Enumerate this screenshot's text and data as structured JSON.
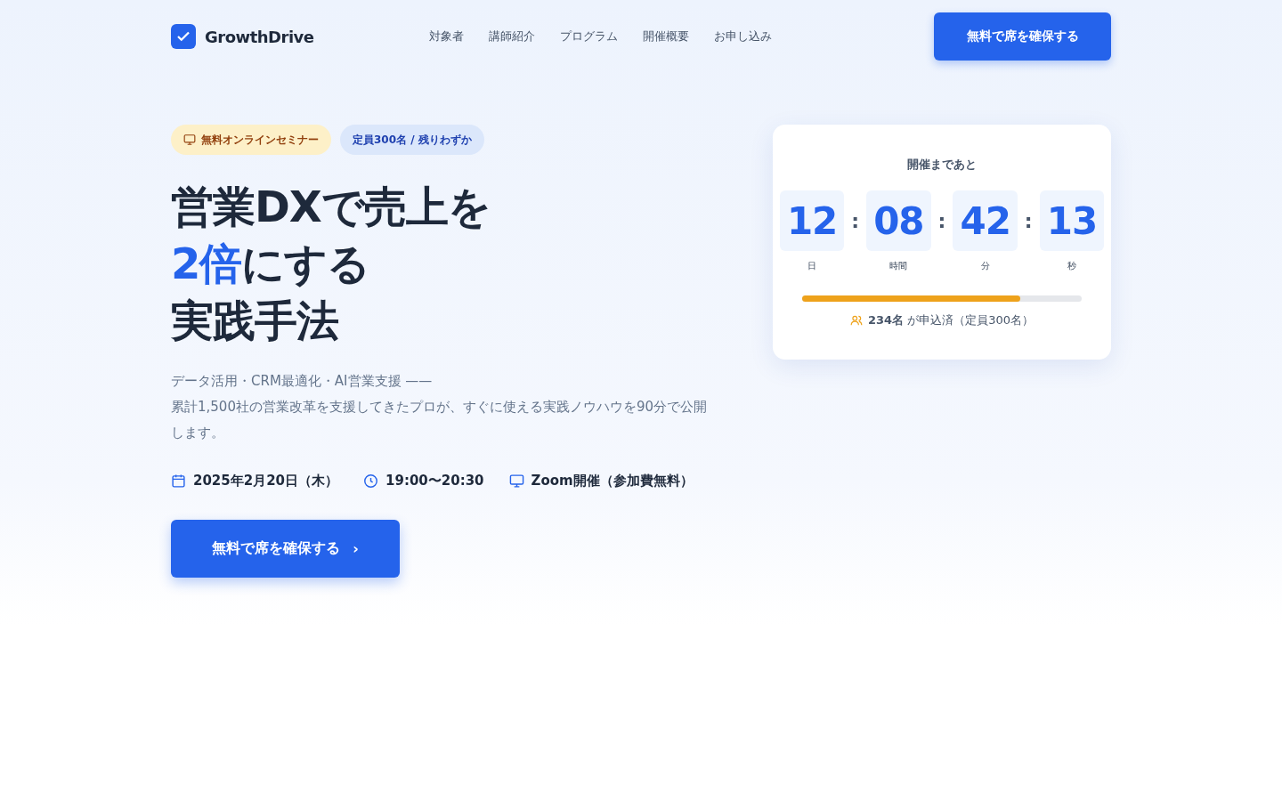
{
  "header": {
    "logo": "GrowthDrive",
    "nav": [
      {
        "label": "対象者"
      },
      {
        "label": "講師紹介"
      },
      {
        "label": "プログラム"
      },
      {
        "label": "開催概要"
      },
      {
        "label": "お申し込み"
      }
    ],
    "cta": "無料で席を確保する"
  },
  "hero": {
    "badges": [
      {
        "kind": "seminar",
        "label": "無料オンラインセミナー"
      },
      {
        "kind": "capacity",
        "label": "定員300名 / 残りわずか"
      }
    ],
    "headline": [
      {
        "text": "営業DXで売上を"
      },
      {
        "highlight": "2倍",
        "text": "にする"
      },
      {
        "text": "実践手法"
      }
    ],
    "description": [
      "データ活用・CRM最適化・AI営業支援 ——",
      "累計1,500社の営業改革を支援してきたプロが、すぐに使える実践ノウハウを90分で公開します。"
    ],
    "meta": [
      {
        "kind": "calendar",
        "text": "2025年2月20日（木）"
      },
      {
        "kind": "clock",
        "text": "19:00〜20:30"
      },
      {
        "kind": "monitor",
        "text": "Zoom開催（参加費無料）"
      }
    ],
    "cta": "無料で席を確保する",
    "cta_arrow": "›"
  },
  "countdown": {
    "title": "開催まであと",
    "units": [
      {
        "value": "12",
        "label": "日"
      },
      {
        "value": "08",
        "label": "時間"
      },
      {
        "value": "42",
        "label": "分"
      },
      {
        "value": "13",
        "label": "秒"
      }
    ],
    "separator": ":",
    "level": 0.78,
    "status": "**234名** が申込済（定員300名）"
  }
}
